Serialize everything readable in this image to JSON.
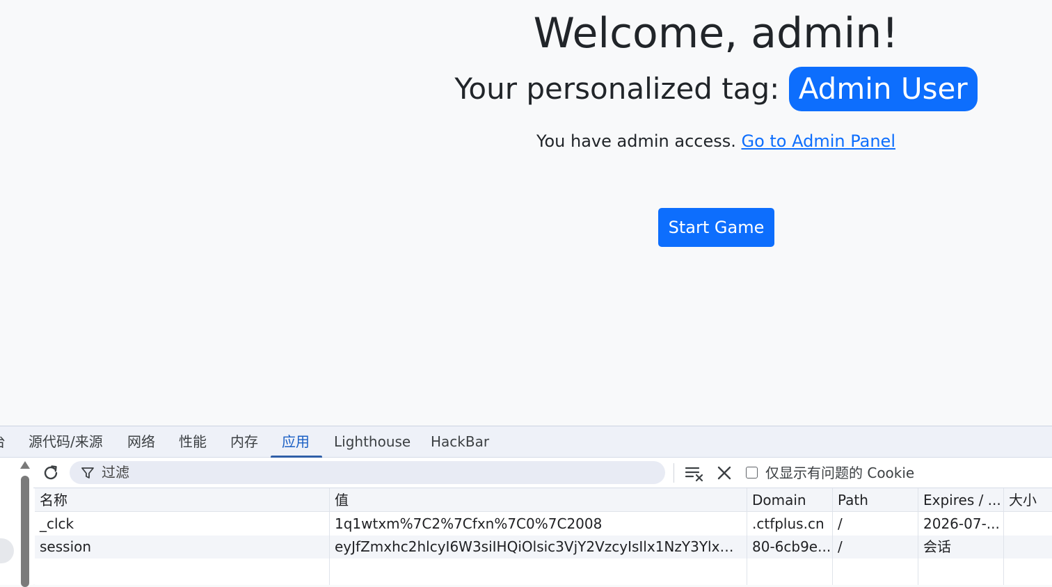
{
  "page": {
    "welcome": "Welcome, admin!",
    "tag_prefix": "Your personalized tag: ",
    "tag": "Admin User",
    "access_text": "You have admin access. ",
    "admin_link": "Go to Admin Panel",
    "start_button": "Start Game",
    "colors": {
      "primary": "#0d6efd",
      "background": "#f8f9fa"
    }
  },
  "devtools": {
    "tabs": [
      {
        "label": "台",
        "active": false
      },
      {
        "label": "源代码/来源",
        "active": false
      },
      {
        "label": "网络",
        "active": false
      },
      {
        "label": "性能",
        "active": false
      },
      {
        "label": "内存",
        "active": false
      },
      {
        "label": "应用",
        "active": true
      },
      {
        "label": "Lighthouse",
        "active": false
      },
      {
        "label": "HackBar",
        "active": false
      }
    ],
    "toolbar": {
      "refresh_icon": "refresh-icon",
      "filter_placeholder": "过滤",
      "filter_icon": "filter-icon",
      "clear_all_icon": "clear-all-icon",
      "close_icon": "close-icon",
      "issues_checkbox_label": "仅显示有问题的 Cookie",
      "issues_checked": false
    },
    "cookies": {
      "columns": [
        "名称",
        "值",
        "Domain",
        "Path",
        "Expires / ...",
        "大小"
      ],
      "rows": [
        {
          "name": "_clck",
          "value": "1q1wtxm%7C2%7Cfxn%7C0%7C2008",
          "domain": ".ctfplus.cn",
          "path": "/",
          "expires": "2026-07-...",
          "size": ""
        },
        {
          "name": "session",
          "value": "eyJfZmxhc2hlcyI6W3siIHQiOlsic3VjY2VzcyIsIlx1NzY3Ylx1N...",
          "domain": "80-6cb9e...",
          "path": "/",
          "expires": "会话",
          "size": ""
        }
      ]
    }
  }
}
